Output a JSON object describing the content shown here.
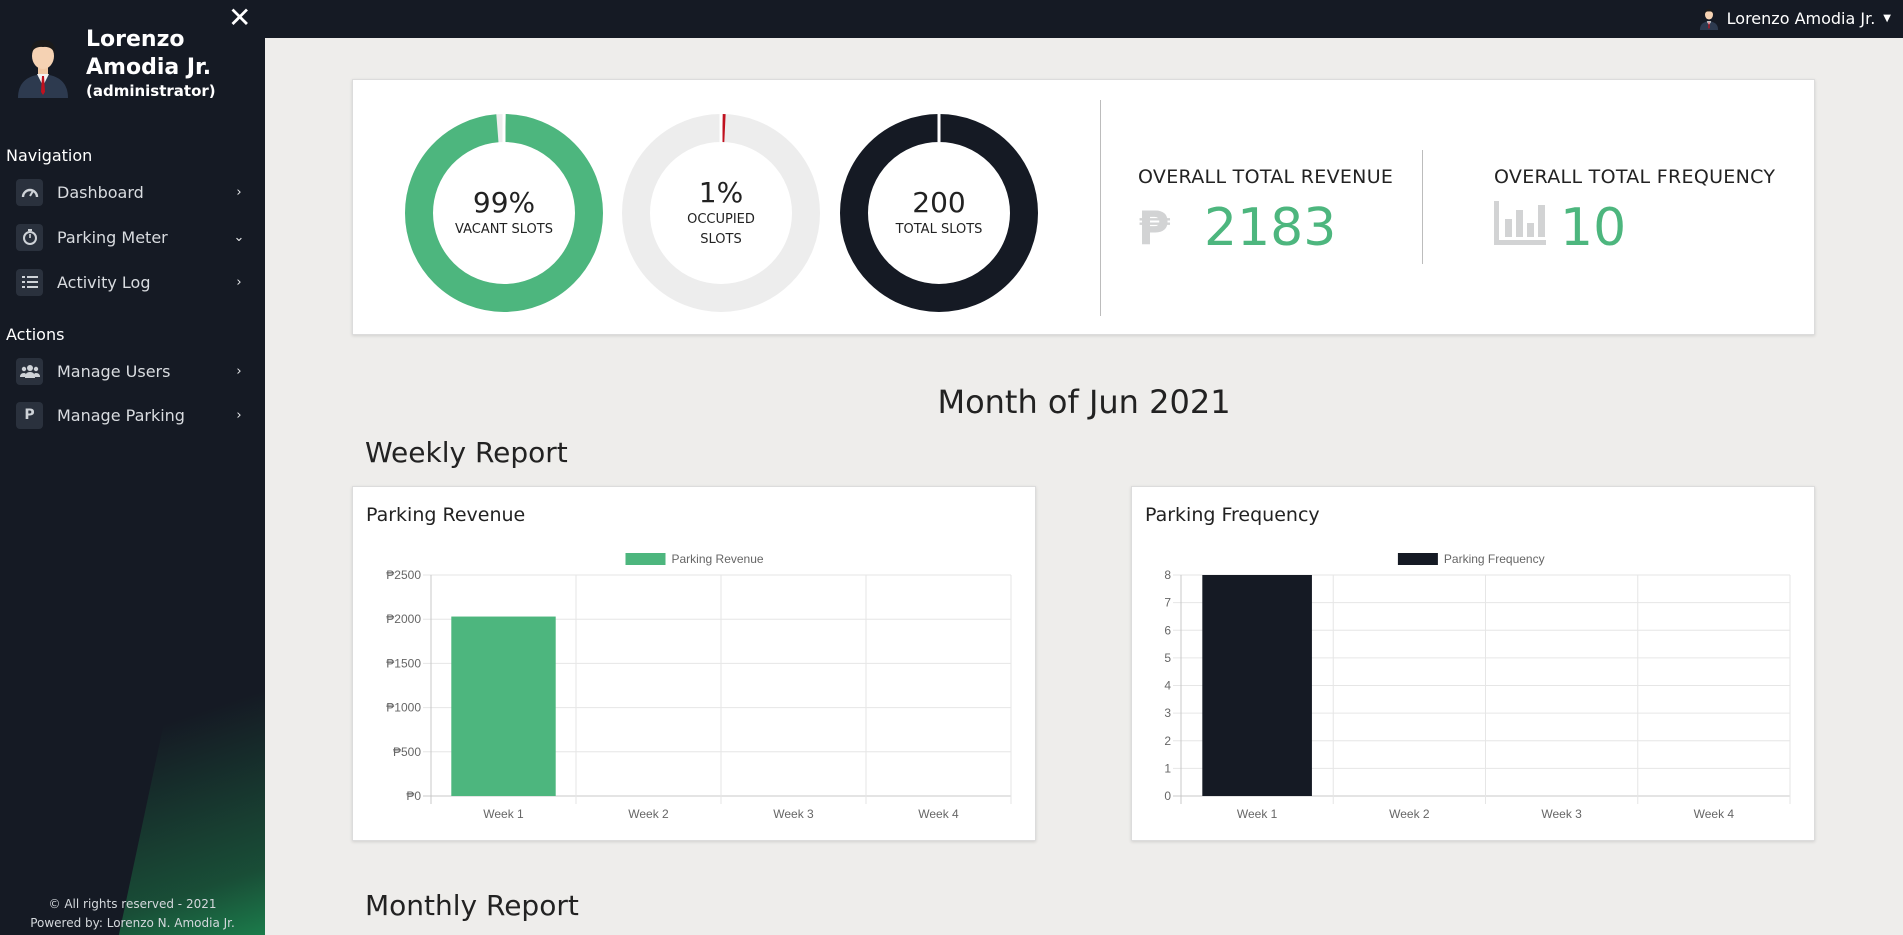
{
  "user": {
    "name": "Lorenzo Amodia Jr.",
    "role": "(administrator)"
  },
  "sidebar": {
    "close_glyph": "✕",
    "navigation_heading": "Navigation",
    "actions_heading": "Actions",
    "navigation": [
      {
        "label": "Dashboard",
        "icon": "gauge-icon",
        "chevron": "›"
      },
      {
        "label": "Parking Meter",
        "icon": "stopwatch-icon",
        "chevron": "⌄"
      },
      {
        "label": "Activity Log",
        "icon": "list-icon",
        "chevron": "›"
      }
    ],
    "actions": [
      {
        "label": "Manage Users",
        "icon": "users-icon",
        "chevron": "›"
      },
      {
        "label": "Manage Parking",
        "icon": "parking-icon",
        "icon_text": "P",
        "chevron": "›"
      }
    ],
    "footer": {
      "copyright": "© All rights reserved - 2021",
      "powered": "Powered by: Lorenzo N. Amodia Jr."
    }
  },
  "topbar": {
    "user_name": "Lorenzo Amodia Jr.",
    "caret": "▼"
  },
  "stats": {
    "vacant": {
      "value": "99%",
      "label": "VACANT SLOTS",
      "fraction": 0.99,
      "color": "#4db67e"
    },
    "occupied": {
      "value": "1%",
      "label": "OCCUPIED SLOTS",
      "fraction": 0.01,
      "color": "#c0111f"
    },
    "total": {
      "value": "200",
      "label": "TOTAL SLOTS",
      "fraction": 1.0,
      "color": "#151a24"
    },
    "revenue": {
      "title": "OVERALL TOTAL REVENUE",
      "currency": "₱",
      "value": "2183"
    },
    "frequency": {
      "title": "OVERALL TOTAL FREQUENCY",
      "icon": "bar-chart-icon",
      "value": "10"
    }
  },
  "month_title": "Month of Jun 2021",
  "weekly_title": "Weekly Report",
  "monthly_title": "Monthly Report",
  "chart_data": [
    {
      "type": "bar",
      "title": "Parking Revenue",
      "categories": [
        "Week 1",
        "Week 2",
        "Week 3",
        "Week 4"
      ],
      "series": [
        {
          "name": "Parking Revenue",
          "values": [
            2030,
            0,
            0,
            0
          ],
          "color": "#4db67e"
        }
      ],
      "ylim": [
        0,
        2500
      ],
      "yticks": [
        0,
        500,
        1000,
        1500,
        2000,
        2500
      ],
      "ytick_prefix": "₱",
      "legend": "top-center",
      "grid": true
    },
    {
      "type": "bar",
      "title": "Parking Frequency",
      "categories": [
        "Week 1",
        "Week 2",
        "Week 3",
        "Week 4"
      ],
      "series": [
        {
          "name": "Parking Frequency",
          "values": [
            8,
            0,
            0,
            0
          ],
          "color": "#151a24"
        }
      ],
      "ylim": [
        0,
        8
      ],
      "yticks": [
        0,
        1,
        2,
        3,
        4,
        5,
        6,
        7,
        8
      ],
      "ytick_prefix": "",
      "legend": "top-center",
      "grid": true
    }
  ]
}
